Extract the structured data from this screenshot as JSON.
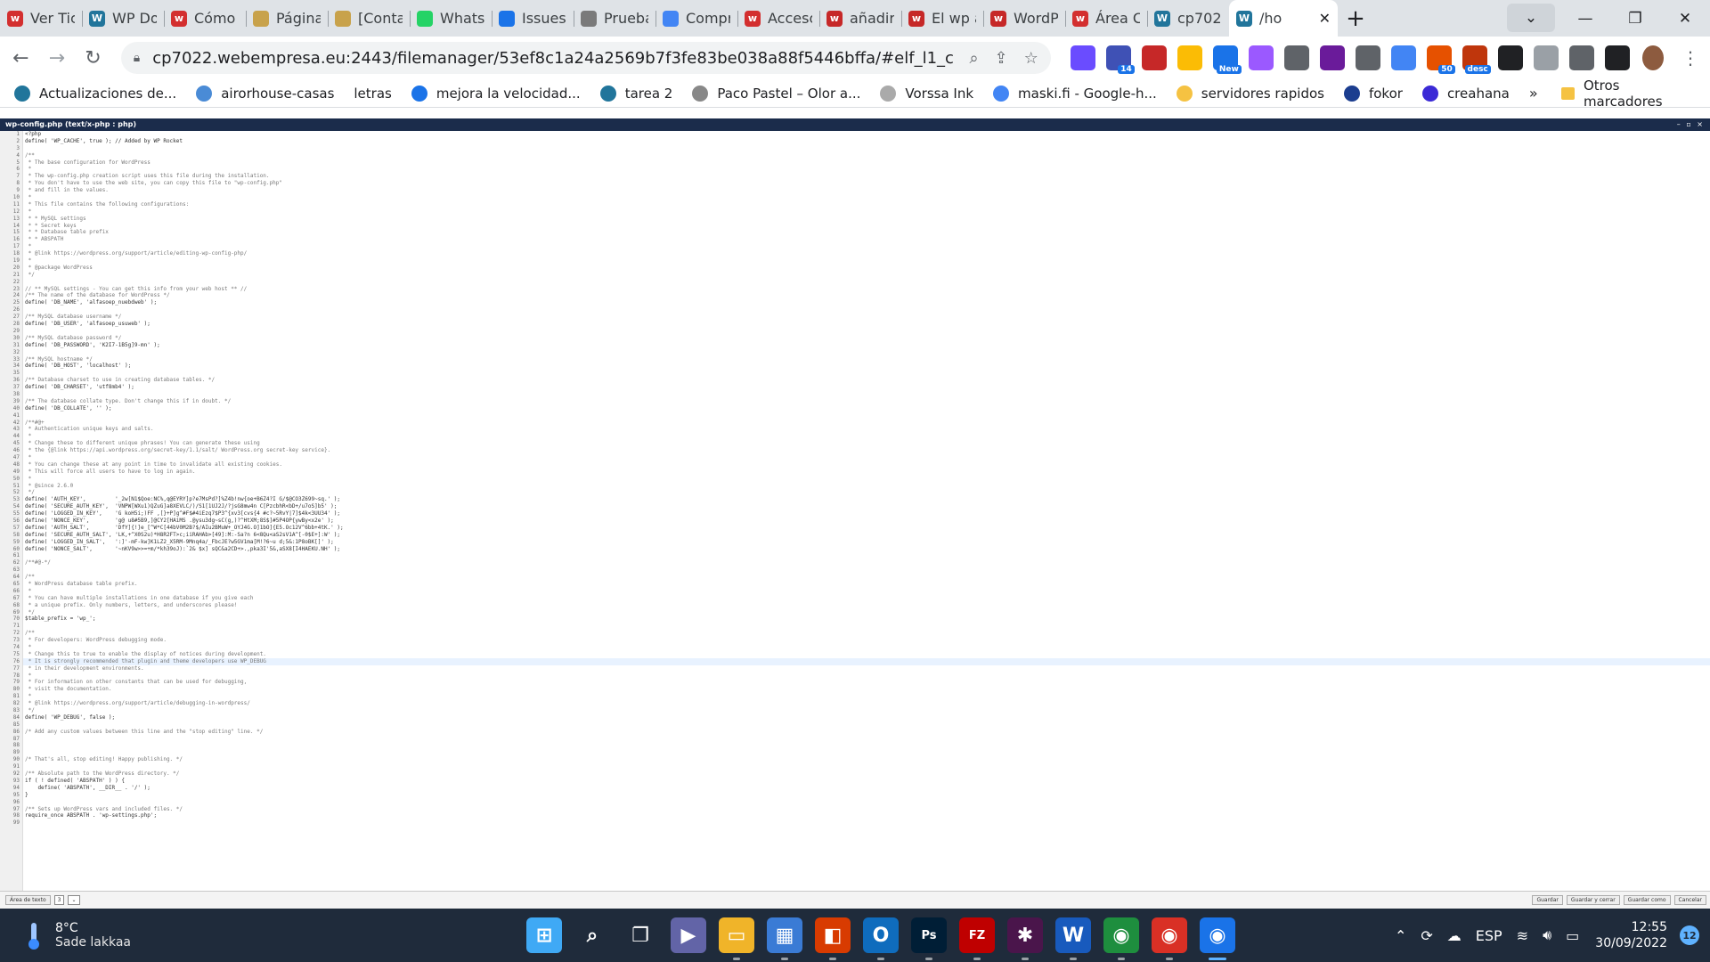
{
  "browser": {
    "tabs": [
      {
        "label": "Ver Tic",
        "icon": "webempresa-icon",
        "color": "#d32f2f"
      },
      {
        "label": "WP Do",
        "icon": "wordpress-icon",
        "color": "#21759b"
      },
      {
        "label": "Cómo a",
        "icon": "webempresa-icon",
        "color": "#d32f2f"
      },
      {
        "label": "Página",
        "icon": "image-icon",
        "color": "#c8a24b"
      },
      {
        "label": "[Conta",
        "icon": "image-icon",
        "color": "#c8a24b"
      },
      {
        "label": "WhatsA",
        "icon": "whatsapp-icon",
        "color": "#25d366"
      },
      {
        "label": "Issues",
        "icon": "checkbox-icon",
        "color": "#1a73e8"
      },
      {
        "label": "Prueba",
        "icon": "drive-icon",
        "color": "#7a7a7a"
      },
      {
        "label": "Compr",
        "icon": "google-icon",
        "color": "#4285f4"
      },
      {
        "label": "Acceso",
        "icon": "webempresa-icon",
        "color": "#d32f2f"
      },
      {
        "label": "añadir",
        "icon": "webempresa-icon",
        "color": "#c62828"
      },
      {
        "label": "El wp a",
        "icon": "webempresa-icon",
        "color": "#c62828"
      },
      {
        "label": "WordPr",
        "icon": "webempresa-icon",
        "color": "#c62828"
      },
      {
        "label": "Área C",
        "icon": "webempresa-icon",
        "color": "#d32f2f"
      },
      {
        "label": "cp7022",
        "icon": "wordpress-icon",
        "color": "#21759b"
      },
      {
        "label": "/ho",
        "icon": "wordpress-icon",
        "color": "#21759b",
        "active": true
      }
    ],
    "url": "cp7022.webempresa.eu:2443/filemanager/53ef8c1a24a2569b7f3fe83be038a88f5446bffa/#elf_l1_cHVibGljX2h0b...",
    "bookmarks": [
      {
        "label": "Actualizaciones de...",
        "color": "#21759b"
      },
      {
        "label": "airorhouse-casas",
        "color": "#4a8bd6"
      },
      {
        "label": "letras",
        "color": ""
      },
      {
        "label": "mejora la velocidad...",
        "color": "#1a73e8"
      },
      {
        "label": "tarea 2",
        "color": "#21759b"
      },
      {
        "label": "Paco Pastel – Olor a...",
        "color": "#888888"
      },
      {
        "label": "Vorssa Ink",
        "color": "#aaaaaa"
      },
      {
        "label": "maski.fi - Google-h...",
        "color": "#4285f4"
      },
      {
        "label": "servidores rapidos",
        "color": "#f5c242"
      },
      {
        "label": "fokor",
        "color": "#1b3d8f"
      },
      {
        "label": "creahana",
        "color": "#3b2ad6"
      }
    ],
    "bookmarks_more": "»",
    "other_bookmarks": "Otros marcadores",
    "extensions": [
      {
        "name": "flower-icon",
        "color": "#6a4cff"
      },
      {
        "name": "graduation-cap-icon",
        "color": "#3f51b5",
        "badge": "14"
      },
      {
        "name": "seo-icon",
        "color": "#c62828"
      },
      {
        "name": "pen-icon",
        "color": "#fbbc05"
      },
      {
        "name": "new-icon",
        "color": "#1a73e8",
        "badge": "New"
      },
      {
        "name": "tag-icon",
        "color": "#9b59ff"
      },
      {
        "name": "document-icon",
        "color": "#5f6368"
      },
      {
        "name": "gallery-icon",
        "color": "#6a1b9a"
      },
      {
        "name": "wand-icon",
        "color": "#5f6368"
      },
      {
        "name": "translate-icon",
        "color": "#4285f4"
      },
      {
        "name": "so-icon",
        "color": "#e65100",
        "badge": "50"
      },
      {
        "name": "desc-icon",
        "color": "#bf360c",
        "badge": "desc"
      },
      {
        "name": "function-icon",
        "color": "#202124"
      },
      {
        "name": "camera-icon",
        "color": "#9aa0a6"
      },
      {
        "name": "puzzle-icon",
        "color": "#5f6368"
      },
      {
        "name": "sidebar-icon",
        "color": "#202124"
      }
    ]
  },
  "editor": {
    "title": "wp-config.php (text/x-php : php)",
    "controls": "– ▫ ×",
    "lines": [
      "<?php",
      "define( 'WP_CACHE', true ); // Added by WP Rocket",
      "",
      "/**",
      " * The base configuration for WordPress",
      " *",
      " * The wp-config.php creation script uses this file during the installation.",
      " * You don't have to use the web site, you can copy this file to \"wp-config.php\"",
      " * and fill in the values.",
      " *",
      " * This file contains the following configurations:",
      " *",
      " * * MySQL settings",
      " * * Secret keys",
      " * * Database table prefix",
      " * * ABSPATH",
      " *",
      " * @link https://wordpress.org/support/article/editing-wp-config-php/",
      " *",
      " * @package WordPress",
      " */",
      "",
      "// ** MySQL settings - You can get this info from your web host ** //",
      "/** The name of the database for WordPress */",
      "define( 'DB_NAME', 'alfasoep_nuebdweb' );",
      "",
      "/** MySQL database username */",
      "define( 'DB_USER', 'alfasoep_usuweb' );",
      "",
      "/** MySQL database password */",
      "define( 'DB_PASSWORD', 'K2I7-1B5g]9-mn' );",
      "",
      "/** MySQL hostname */",
      "define( 'DB_HOST', 'localhost' );",
      "",
      "/** Database charset to use in creating database tables. */",
      "define( 'DB_CHARSET', 'utf8mb4' );",
      "",
      "/** The database collate type. Don't change this if in doubt. */",
      "define( 'DB_COLLATE', '' );",
      "",
      "/**#@+",
      " * Authentication unique keys and salts.",
      " *",
      " * Change these to different unique phrases! You can generate these using",
      " * the {@link https://api.wordpress.org/secret-key/1.1/salt/ WordPress.org secret-key service}.",
      " *",
      " * You can change these at any point in time to invalidate all existing cookies.",
      " * This will force all users to have to log in again.",
      " *",
      " * @since 2.6.0",
      " */",
      "define( 'AUTH_KEY',         '_2w[N1$Qoe:NC%,q@EYRY]p?e7MsPd?]%Z4b!nw{oe+B6Z4?I G/$@CO3Z699~sq.' );",
      "define( 'SECURE_AUTH_KEY',  'VNPW[WXu1)QZuG]a8XEVLC/)/S1[1UJ2J/?jsG8mw4n C[PzcbhR<bD+/u7oS]b5' );",
      "define( 'LOGGED_IN_KEY',    'G koH5i;)FF ,[}+P]g^#F$#4iEzq7$P3^{xv3[cvs{4 #c?~5RvY|7]$4k<3UU34' );",
      "define( 'NONCE_KEY',        'g@ u8#5B9,]@CY2[HAiMS .@ysu3dg~sC(g,)?^HtXM;8S$]#5P4OP{ywBy<x2e' );",
      "define( 'AUTH_SALT',        'DfY]{!]e_[^W*C[44bV0M2B?$/AIu2BMuW+_OYJ4G.O]1bO]{E5.Oc12V^6bb+4tK.' );",
      "define( 'SECURE_AUTH_SALT', 'LK,+^X0S2u)*H8R2FT>c;iiRAHAb>[49]:M:-Sa?n 6<8Qu<aS2sV1A^[-0$E+]:W' );",
      "define( 'LOGGED_IN_SALT',   ':]'-mF-kw]K1LZ2_X5RM-9Mnq4a/_FbcJE?w5GV1ma[M!?6~u d;5&:1P8oBK[]' );",
      "define( 'NONCE_SALT',       '~nKV9w>>=+m/*kh39oJ):`2& $x] sQC&a2CD+>.,pka3I'5&,aSX8[I4HAEKU.NH' );",
      "",
      "/**#@-*/",
      "",
      "/**",
      " * WordPress database table prefix.",
      " *",
      " * You can have multiple installations in one database if you give each",
      " * a unique prefix. Only numbers, letters, and underscores please!",
      " */",
      "$table_prefix = 'wp_';",
      "",
      "/**",
      " * For developers: WordPress debugging mode.",
      " *",
      " * Change this to true to enable the display of notices during development.",
      " * It is strongly recommended that plugin and theme developers use WP_DEBUG",
      " * in their development environments.",
      " *",
      " * For information on other constants that can be used for debugging,",
      " * visit the documentation.",
      " *",
      " * @link https://wordpress.org/support/article/debugging-in-wordpress/",
      " */",
      "define( 'WP_DEBUG', false );",
      "",
      "/* Add any custom values between this line and the \"stop editing\" line. */",
      "",
      "",
      "",
      "/* That's all, stop editing! Happy publishing. */",
      "",
      "/** Absolute path to the WordPress directory. */",
      "if ( ! defined( 'ABSPATH' ) ) {",
      "    define( 'ABSPATH', __DIR__ . '/' );",
      "}",
      "",
      "/** Sets up WordPress vars and included files. */",
      "require_once ABSPATH . 'wp-settings.php';",
      ""
    ],
    "current_line": 76,
    "footer": {
      "mode_label": "Área de texto",
      "font_size": "3",
      "buttons": [
        "Guardar",
        "Guardar y cerrar",
        "Guardar como",
        "Cancelar"
      ]
    }
  },
  "taskbar": {
    "temperature": "8°C",
    "condition": "Sade lakkaa",
    "apps": [
      {
        "name": "windows-start-icon",
        "color": "#3fa9f5",
        "glyph": "⊞"
      },
      {
        "name": "search-icon",
        "color": "",
        "glyph": "⌕"
      },
      {
        "name": "task-view-icon",
        "color": "",
        "glyph": "❐"
      },
      {
        "name": "teams-chat-icon",
        "color": "#6264a7",
        "glyph": "▶"
      },
      {
        "name": "file-explorer-icon",
        "color": "#f0b429",
        "glyph": "▭"
      },
      {
        "name": "store-icon",
        "color": "#3a7bd5",
        "glyph": "▦"
      },
      {
        "name": "office-icon",
        "color": "#d83b01",
        "glyph": "◧"
      },
      {
        "name": "outlook-icon",
        "color": "#0f6cbd",
        "glyph": "O"
      },
      {
        "name": "photoshop-icon",
        "color": "#001e36",
        "glyph": "Ps"
      },
      {
        "name": "filezilla-icon",
        "color": "#bf0000",
        "glyph": "FZ"
      },
      {
        "name": "slack-icon",
        "color": "#4a154b",
        "glyph": "✱"
      },
      {
        "name": "word-icon",
        "color": "#185abd",
        "glyph": "W"
      },
      {
        "name": "chrome-icon",
        "color": "#1e8e3e",
        "glyph": "◉"
      },
      {
        "name": "chrome-profile-icon",
        "color": "#d93025",
        "glyph": "◉"
      },
      {
        "name": "chrome-active-icon",
        "color": "#1a73e8",
        "glyph": "◉"
      }
    ],
    "language": "ESP",
    "time": "12:55",
    "date": "30/09/2022",
    "notifications": "12"
  }
}
